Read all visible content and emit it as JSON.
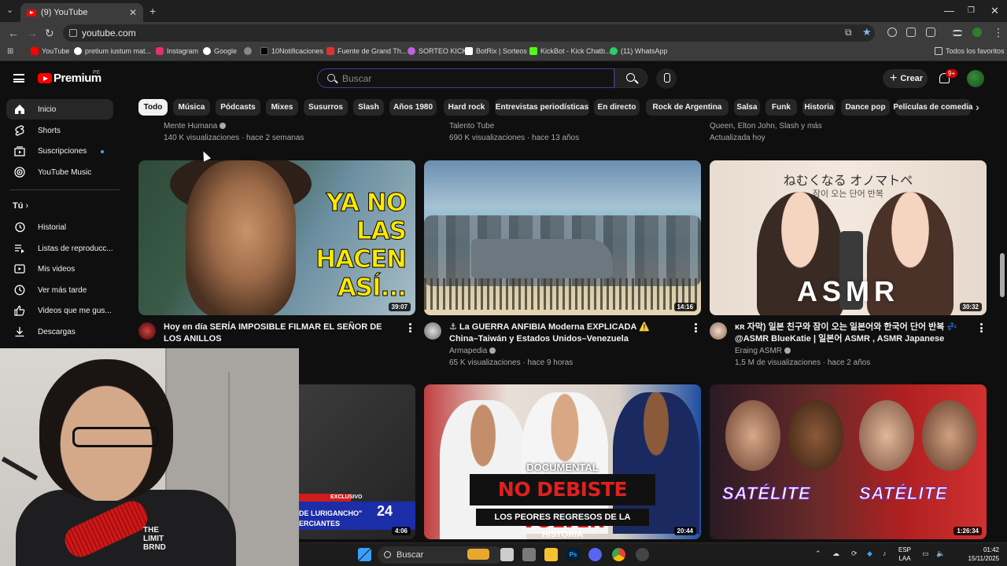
{
  "browser": {
    "tab_title": "(9) YouTube",
    "url": "youtube.com",
    "bookmarks": [
      {
        "label": "YouTube",
        "color": "#ff0000"
      },
      {
        "label": "pretium iustum mat...",
        "color": "#ffffff"
      },
      {
        "label": "Instagram",
        "color": "#e1306c"
      },
      {
        "label": "Google",
        "color": "#ffffff"
      },
      {
        "label": "",
        "color": "#888888"
      },
      {
        "label": "10Notificaciones",
        "color": "#000000"
      },
      {
        "label": "Fuente de Grand Th...",
        "color": "#e03030"
      },
      {
        "label": "SORTEO KICK",
        "color": "#c060e0"
      },
      {
        "label": "BotRix | Sorteos",
        "color": "#ffffff"
      },
      {
        "label": "KickBot - Kick Chatb...",
        "color": "#53fc18"
      },
      {
        "label": "(11) WhatsApp",
        "color": "#25d366"
      }
    ],
    "all_favorites": "Todos los favoritos"
  },
  "header": {
    "logo": "Premium",
    "region": "PE",
    "search_placeholder": "Buscar",
    "create_label": "Crear",
    "notifications": "9+"
  },
  "chips": [
    "Todo",
    "Música",
    "Pódcasts",
    "Mixes",
    "Susurros",
    "Slash",
    "Años 1980",
    "Hard rock",
    "Entrevistas periodísticas",
    "En directo",
    "Rock de Argentina",
    "Salsa",
    "Funk",
    "Historia",
    "Dance pop",
    "Películas de comedia"
  ],
  "sidebar": {
    "main": [
      {
        "label": "Inicio",
        "icon": "home-icon"
      },
      {
        "label": "Shorts",
        "icon": "shorts-icon"
      },
      {
        "label": "Suscripciones",
        "icon": "subscriptions-icon"
      },
      {
        "label": "YouTube Music",
        "icon": "youtube-music-icon"
      }
    ],
    "you_label": "Tú",
    "you": [
      {
        "label": "Historial",
        "icon": "history-icon"
      },
      {
        "label": "Listas de reproducc...",
        "icon": "playlists-icon"
      },
      {
        "label": "Mis videos",
        "icon": "my-videos-icon"
      },
      {
        "label": "Ver más tarde",
        "icon": "watch-later-icon"
      },
      {
        "label": "Videos que me gus...",
        "icon": "liked-videos-icon"
      },
      {
        "label": "Descargas",
        "icon": "downloads-icon"
      }
    ]
  },
  "prev_row": [
    {
      "channel": "Mente Humana",
      "stats": "140 K visualizaciones · hace 2 semanas"
    },
    {
      "channel": "Talento Tube",
      "stats": "690 K visualizaciones · hace 13 años"
    },
    {
      "channel": "Queen, Elton John, Slash y más",
      "stats": "Actualizada hoy"
    }
  ],
  "videos": [
    {
      "title": "Hoy en día SERÍA IMPOSIBLE FILMAR EL SEÑOR DE LOS ANILLOS",
      "channel": "",
      "stats": "",
      "duration": "39:07",
      "thumb_text": "YA NO LAS HACEN ASÍ..."
    },
    {
      "title": "⚓ La GUERRA ANFIBIA Moderna EXPLICADA ⚠️ China–Taiwán y Estados Unidos–Venezuela",
      "channel": "Armapedia",
      "stats": "65 K visualizaciones · hace 9 horas",
      "duration": "14:16"
    },
    {
      "title": "ᴋʀ 자막) 일본 친구와 잠이 오는 일본어와 한국어 단어 반복 💤 @ASMR BlueKatie | 일본어 ASMR , ASMR Japanese",
      "channel": "Eraing ASMR",
      "stats": "1,5 M de visualizaciones · hace 2 años",
      "duration": "30:32",
      "thumb_jp": "ねむくなる オノマトペ",
      "thumb_kr": "잠이 오는 단어 반복",
      "thumb_main": "ASMR"
    }
  ],
  "bottom_row": [
    {
      "duration": "4:06",
      "badge": "EXCLUSIVO",
      "number": "24",
      "line1": "DE LURIGANCHO\"",
      "line2": "ERCIANTES"
    },
    {
      "duration": "20:44",
      "kicker": "DOCUMENTAL",
      "headline": "NO DEBISTE VOLVER",
      "subline": "LOS PEORES REGRESOS DE LA HISTORIA"
    },
    {
      "duration": "1:26:34",
      "brand": "SATÉLITE"
    }
  ],
  "taskbar": {
    "search": "Buscar",
    "lang1": "ESP",
    "lang2": "LAA",
    "time": "01:42",
    "date": "15/11/2025"
  },
  "webcam": {
    "shirt_text": "THE\nLIMIT\nBRND"
  },
  "colors": {
    "youtube_red": "#ff0000",
    "accent_blue": "#3ea6ff",
    "bg": "#0f0f0f"
  }
}
